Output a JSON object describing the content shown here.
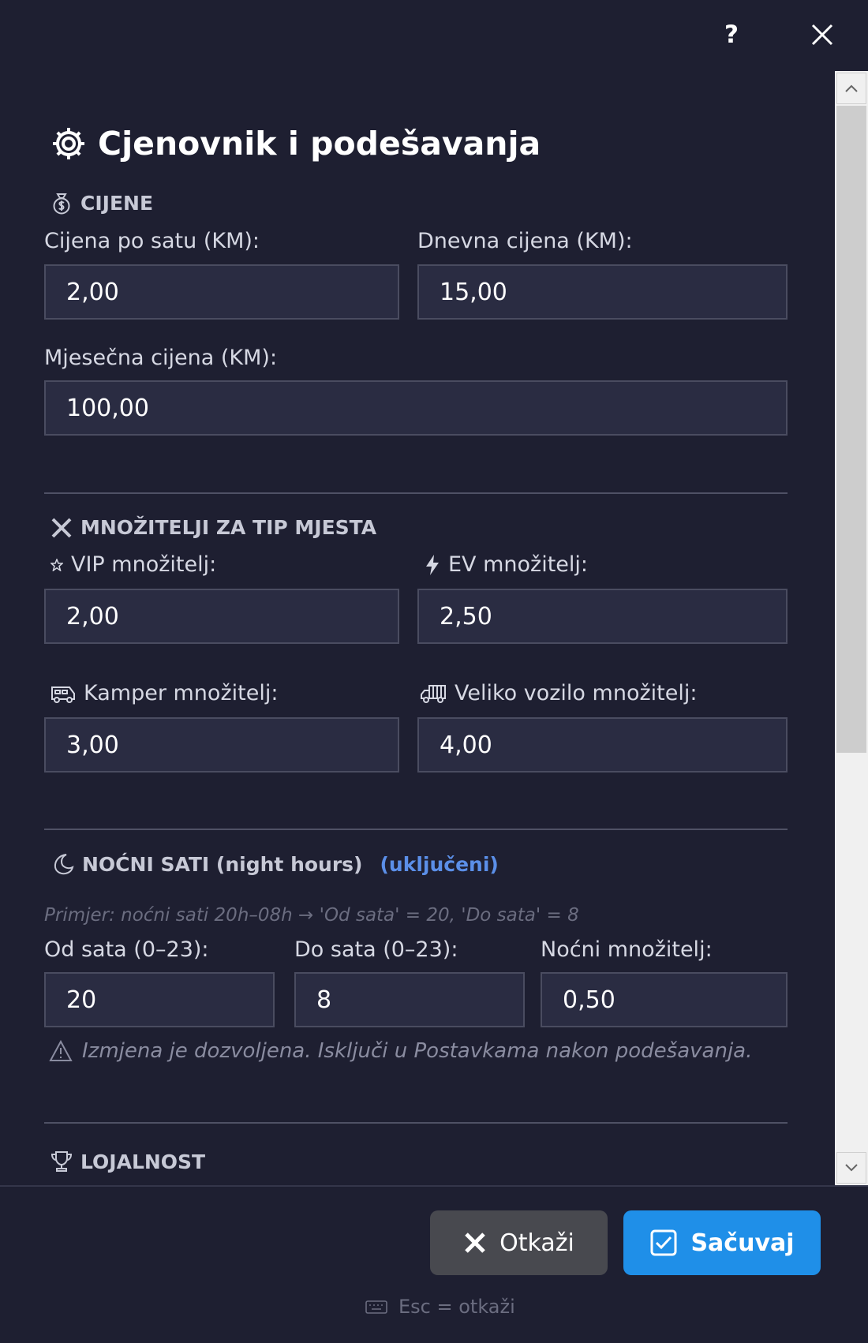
{
  "topbar": {
    "help_label": "?",
    "close_icon": "close-icon"
  },
  "page": {
    "title": "Cjenovnik i podešavanja",
    "title_icon": "gear-icon"
  },
  "prices": {
    "section_title": "CIJENE",
    "section_icon": "money-bag-icon",
    "hourly_label": "Cijena po satu (KM):",
    "hourly_value": "2,00",
    "daily_label": "Dnevna cijena (KM):",
    "daily_value": "15,00",
    "monthly_label": "Mjesečna cijena (KM):",
    "monthly_value": "100,00"
  },
  "multipliers": {
    "section_title": "MNOŽITELJI ZA TIP MJESTA",
    "section_icon": "multiply-icon",
    "vip_label": "VIP množitelj:",
    "vip_value": "2,00",
    "ev_label": "EV množitelj:",
    "ev_value": "2,50",
    "camper_label": "Kamper množitelj:",
    "camper_value": "3,00",
    "large_label": "Veliko vozilo množitelj:",
    "large_value": "4,00"
  },
  "night": {
    "section_title": "NOĆNI SATI (night hours)",
    "status": "(uključeni)",
    "section_icon": "moon-icon",
    "hint": "Primjer: noćni sati 20h–08h → 'Od sata' = 20,  'Do sata' = 8",
    "from_label": "Od sata (0–23):",
    "from_value": "20",
    "to_label": "Do sata (0–23):",
    "to_value": "8",
    "mult_label": "Noćni množitelj:",
    "mult_value": "0,50",
    "warning": "Izmjena je dozvoljena. Isključi u Postavkama nakon podešavanja."
  },
  "loyalty": {
    "section_title": "LOJALNOST",
    "section_icon": "trophy-icon"
  },
  "footer": {
    "cancel_label": "Otkaži",
    "save_label": "Sačuvaj",
    "esc_hint": "Esc = otkaži"
  },
  "colors": {
    "background": "#1e1f31",
    "field_bg": "#2a2c42",
    "accent": "#5b8fe8",
    "save_button": "#1f8fe8",
    "cancel_button": "#48494f"
  }
}
